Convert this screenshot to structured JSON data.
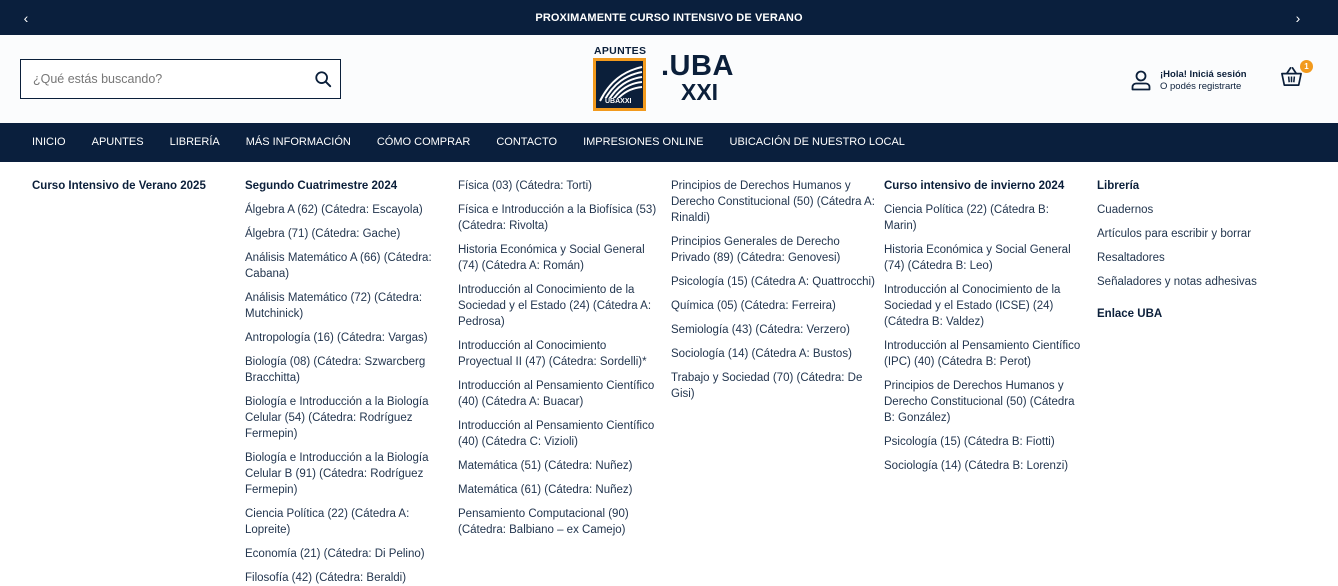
{
  "topbar": {
    "prev": "‹",
    "next": "›",
    "announcement": "PROXIMAMENTE CURSO INTENSIVO DE VERANO"
  },
  "header": {
    "search_placeholder": "¿Qué estás buscando?",
    "logo_apuntes": "APUNTES",
    "logo_badge": "UBAXXI",
    "logo_uba": ".UBA",
    "logo_xxi": "XXI",
    "account_line1": "¡Hola! Iniciá sesión",
    "account_line2": "O podés registrarte",
    "cart_count": "1"
  },
  "nav": [
    "INICIO",
    "APUNTES",
    "LIBRERÍA",
    "MÁS INFORMACIÓN",
    "CÓMO COMPRAR",
    "CONTACTO",
    "IMPRESIONES ONLINE",
    "UBICACIÓN DE NUESTRO LOCAL"
  ],
  "mega": {
    "col1": {
      "title": "Curso Intensivo de Verano 2025"
    },
    "col2": {
      "title": "Segundo Cuatrimestre 2024",
      "items": [
        "Álgebra A (62) (Cátedra: Escayola)",
        "Álgebra (71) (Cátedra: Gache)",
        "Análisis Matemático A (66) (Cátedra: Cabana)",
        "Análisis Matemático (72) (Cátedra: Mutchinick)",
        "Antropología (16) (Cátedra: Vargas)",
        "Biología (08) (Cátedra: Szwarcberg Bracchitta)",
        "Biología e Introducción a la Biología Celular (54) (Cátedra: Rodríguez Fermepin)",
        "Biología e Introducción a la Biología Celular B (91) (Cátedra: Rodríguez Fermepin)",
        "Ciencia Política (22) (Cátedra A: Lopreite)",
        "Economía (21) (Cátedra: Di Pelino)",
        "Filosofía (42) (Cátedra: Beraldi)"
      ]
    },
    "col3": {
      "items": [
        "Física (03) (Cátedra: Torti)",
        "Física e Introducción a la Biofísica (53) (Cátedra: Rivolta)",
        "Historia Económica y Social General (74) (Cátedra A: Román)",
        "Introducción al Conocimiento de la Sociedad y el Estado (24) (Cátedra A: Pedrosa)",
        "Introducción al Conocimiento Proyectual II (47) (Cátedra: Sordelli)*",
        "Introducción al Pensamiento Científico (40) (Cátedra A: Buacar)",
        "Introducción al Pensamiento Científico (40) (Cátedra C: Vizioli)",
        "Matemática (51) (Cátedra: Nuñez)",
        "Matemática (61) (Cátedra: Nuñez)",
        "Pensamiento Computacional (90) (Cátedra: Balbiano – ex Camejo)"
      ]
    },
    "col4": {
      "items": [
        "Principios de Derechos Humanos y Derecho Constitucional (50) (Cátedra A: Rinaldi)",
        "Principios Generales de Derecho Privado (89) (Cátedra: Genovesi)",
        "Psicología (15) (Cátedra A: Quattrocchi)",
        "Química (05) (Cátedra: Ferreira)",
        "Semiología (43) (Cátedra: Verzero)",
        "Sociología (14) (Cátedra A: Bustos)",
        "Trabajo y Sociedad (70) (Cátedra: De Gisi)"
      ]
    },
    "col5": {
      "title": "Curso intensivo de invierno 2024",
      "items": [
        "Ciencia Política (22) (Cátedra B: Marin)",
        "Historia Económica y Social General (74) (Cátedra B: Leo)",
        "Introducción al Conocimiento de la Sociedad y el Estado (ICSE) (24) (Cátedra B: Valdez)",
        "Introducción al Pensamiento Científico (IPC) (40) (Cátedra B: Perot)",
        "Principios de Derechos Humanos y Derecho Constitucional (50) (Cátedra B: González)",
        "Psicología (15) (Cátedra B: Fiotti)",
        "Sociología (14) (Cátedra B: Lorenzi)"
      ]
    },
    "col6": {
      "title": "Librería",
      "items": [
        "Cuadernos",
        "Artículos para escribir y borrar",
        "Resaltadores",
        "Señaladores y notas adhesivas"
      ],
      "title2": "Enlace UBA"
    }
  }
}
